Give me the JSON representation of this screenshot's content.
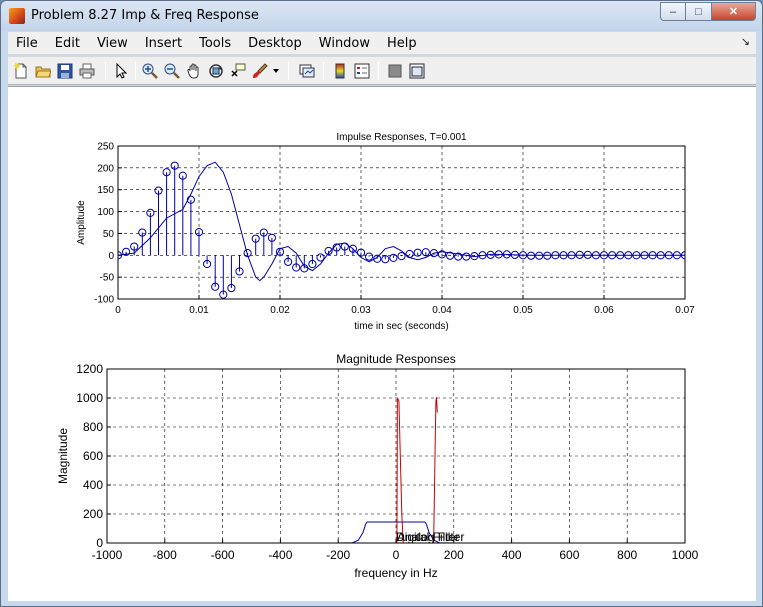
{
  "window": {
    "title": "Problem 8.27 Imp & Freq Response",
    "minimize_glyph": "–",
    "maximize_glyph": "□",
    "close_glyph": "✕"
  },
  "menu": {
    "items": [
      "File",
      "Edit",
      "View",
      "Insert",
      "Tools",
      "Desktop",
      "Window",
      "Help"
    ],
    "dock_arrow": "↘"
  },
  "toolbar": {
    "icons": [
      "new-figure-icon",
      "open-file-icon",
      "save-icon",
      "print-icon",
      "pointer-icon",
      "zoom-in-icon",
      "zoom-out-icon",
      "pan-icon",
      "rotate-3d-icon",
      "data-cursor-icon",
      "brush-icon",
      "brush-dropdown-icon",
      "link-plot-icon",
      "colorbar-icon",
      "legend-icon",
      "hide-tools-icon",
      "show-tools-icon"
    ]
  },
  "chart_data": [
    {
      "type": "line",
      "title": "Impulse Responses, T=0.001",
      "xlabel": "time in sec (seconds)",
      "ylabel": "Amplitude",
      "xlim": [
        0,
        0.07
      ],
      "ylim": [
        -100,
        250
      ],
      "xticks": [
        "0",
        "0.01",
        "0.02",
        "0.03",
        "0.04",
        "0.05",
        "0.06",
        "0.07"
      ],
      "yticks": [
        "-100",
        "-50",
        "0",
        "50",
        "100",
        "150",
        "200",
        "250"
      ],
      "grid": true,
      "series": [
        {
          "style": "stem",
          "color": "#0000aa",
          "x": [
            0,
            0.001,
            0.002,
            0.003,
            0.004,
            0.005,
            0.006,
            0.007,
            0.008,
            0.009,
            0.01,
            0.011,
            0.012,
            0.013,
            0.014,
            0.015,
            0.016,
            0.017,
            0.018,
            0.019,
            0.02,
            0.021,
            0.022,
            0.023,
            0.024,
            0.025,
            0.026,
            0.027,
            0.028,
            0.029,
            0.03,
            0.031,
            0.032,
            0.033,
            0.034,
            0.035,
            0.036,
            0.037,
            0.038,
            0.039,
            0.04,
            0.041,
            0.042,
            0.043,
            0.044,
            0.045,
            0.046,
            0.047,
            0.048,
            0.049,
            0.05,
            0.051,
            0.052,
            0.053,
            0.054,
            0.055,
            0.056,
            0.057,
            0.058,
            0.059,
            0.06,
            0.061,
            0.062,
            0.063,
            0.064,
            0.065,
            0.066,
            0.067,
            0.068,
            0.069,
            0.07
          ],
          "y": [
            0,
            8,
            20,
            52,
            97,
            148,
            190,
            205,
            182,
            127,
            53,
            -20,
            -72,
            -90,
            -75,
            -37,
            5,
            38,
            52,
            40,
            8,
            -15,
            -28,
            -30,
            -20,
            -5,
            10,
            18,
            20,
            15,
            6,
            -3,
            -8,
            -9,
            -6,
            -2,
            3,
            6,
            7,
            5,
            2,
            -1,
            -3,
            -3,
            -2,
            0,
            1,
            2,
            2,
            1,
            0,
            -1,
            -1,
            -1,
            0,
            0,
            0,
            1,
            1,
            0,
            0,
            0,
            0,
            0,
            0,
            0,
            0,
            0,
            0,
            0,
            0
          ]
        },
        {
          "style": "line",
          "color": "#0000aa",
          "x": [
            0,
            0.002,
            0.004,
            0.006,
            0.008,
            0.009,
            0.01,
            0.011,
            0.012,
            0.013,
            0.014,
            0.015,
            0.016,
            0.017,
            0.0175,
            0.018,
            0.019,
            0.02,
            0.021,
            0.022,
            0.023,
            0.024,
            0.025,
            0.026,
            0.027,
            0.028,
            0.029,
            0.03,
            0.031,
            0.032,
            0.033,
            0.034,
            0.035,
            0.036,
            0.037,
            0.038,
            0.039,
            0.04,
            0.042,
            0.044,
            0.046,
            0.048,
            0.05,
            0.055,
            0.06,
            0.065,
            0.07
          ],
          "y": [
            0,
            5,
            40,
            85,
            105,
            140,
            180,
            205,
            213,
            190,
            140,
            70,
            0,
            -50,
            -58,
            -50,
            -20,
            15,
            20,
            5,
            -25,
            -35,
            -20,
            5,
            25,
            28,
            15,
            -5,
            -15,
            -5,
            15,
            20,
            10,
            -5,
            -10,
            -5,
            5,
            8,
            3,
            -3,
            2,
            2,
            0,
            0,
            0,
            0,
            0
          ]
        }
      ]
    },
    {
      "type": "line",
      "title": "Magnitude Responses",
      "xlabel": "frequency in Hz",
      "ylabel": "Magnitude",
      "xlim": [
        -1000,
        1000
      ],
      "ylim": [
        0,
        1200
      ],
      "xticks": [
        "-1000",
        "-800",
        "-600",
        "-400",
        "-200",
        "0",
        "200",
        "400",
        "600",
        "800",
        "1000"
      ],
      "yticks": [
        "0",
        "200",
        "400",
        "600",
        "800",
        "1000",
        "1200"
      ],
      "grid": true,
      "annotations": [
        "Digital Filter",
        "Analog Filter"
      ],
      "series": [
        {
          "style": "line",
          "color": "#0000aa",
          "x": [
            -1000,
            -200,
            -150,
            -130,
            -115,
            -105,
            -100,
            100,
            105,
            115,
            130,
            150,
            200,
            1000
          ],
          "y": [
            0,
            0,
            2,
            20,
            70,
            130,
            145,
            145,
            130,
            70,
            20,
            2,
            0,
            0
          ]
        },
        {
          "style": "line",
          "color": "#cc0000",
          "x": [
            3,
            5,
            10,
            15,
            20,
            25,
            130,
            132,
            135,
            138,
            140,
            143
          ],
          "y": [
            0,
            1000,
            980,
            600,
            200,
            0,
            0,
            200,
            600,
            980,
            1005,
            900
          ]
        }
      ]
    }
  ]
}
